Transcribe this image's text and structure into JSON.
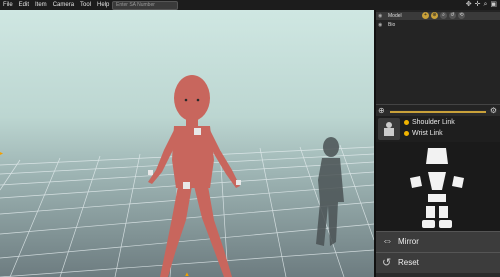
{
  "menu": [
    "File",
    "Edit",
    "Item",
    "Camera",
    "Tool",
    "Help"
  ],
  "search": {
    "placeholder": "Enter SA Number"
  },
  "top_icons": [
    "transform-icon",
    "move-icon",
    "zoom-icon",
    "camera-icon"
  ],
  "model_list": {
    "rows": [
      {
        "label": "Model",
        "selected": true
      },
      {
        "label": "Bio",
        "selected": false
      }
    ],
    "tools": [
      "+",
      "⊕",
      "⌕",
      "↺",
      "⟲"
    ]
  },
  "links": {
    "shoulder": "Shoulder Link",
    "wrist": "Wrist Link"
  },
  "buttons": {
    "mirror": "Mirror",
    "reset": "Reset"
  },
  "colors": {
    "accent": "#f0b400",
    "figure": "#c9675e"
  }
}
